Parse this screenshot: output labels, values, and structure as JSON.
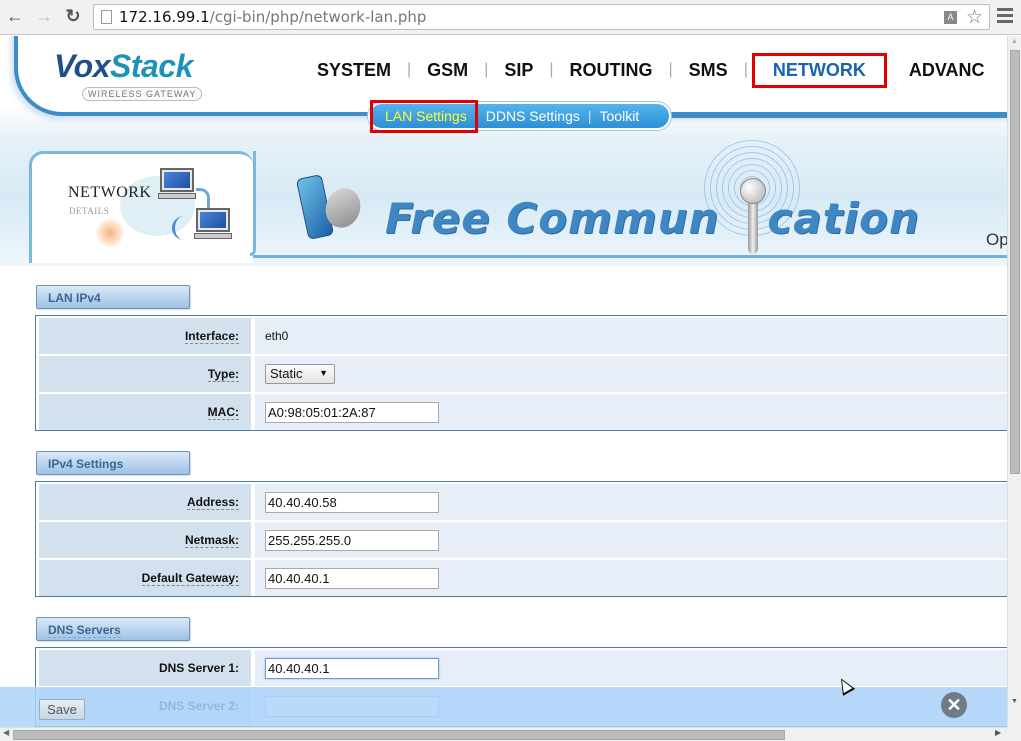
{
  "browser": {
    "url_host": "172.16.99.1",
    "url_path": "/cgi-bin/php/network-lan.php",
    "icons": [
      "back-arrow-icon",
      "forward-arrow-icon",
      "reload-icon",
      "page-icon",
      "translate-icon",
      "star-icon",
      "menu-icon"
    ]
  },
  "logo": {
    "vox": "Vox",
    "stack": "Stack",
    "subtitle": "WIRELESS GATEWAY"
  },
  "main_nav": {
    "items": [
      {
        "label": "SYSTEM"
      },
      {
        "label": "GSM"
      },
      {
        "label": "SIP"
      },
      {
        "label": "ROUTING"
      },
      {
        "label": "SMS"
      },
      {
        "label": "NETWORK",
        "active": true
      },
      {
        "label": "ADVANC"
      }
    ],
    "separator": "|"
  },
  "sub_nav": {
    "items": [
      {
        "label": "LAN Settings",
        "active": true
      },
      {
        "label": "DDNS Settings"
      },
      {
        "label": "Toolkit"
      }
    ],
    "separator": "|"
  },
  "page_card": {
    "title": "NETWORK",
    "subtitle": "DETAILS"
  },
  "banner": {
    "text_left": "Free Commun",
    "text_right": "cation",
    "clipped_text": "Op"
  },
  "sections": [
    {
      "title": "LAN IPv4",
      "rows": [
        {
          "label": "Interface:",
          "type": "text",
          "value": "eth0"
        },
        {
          "label": "Type:",
          "type": "select",
          "value": "Static"
        },
        {
          "label": "MAC:",
          "type": "input",
          "value": "A0:98:05:01:2A:87"
        }
      ]
    },
    {
      "title": "IPv4 Settings",
      "rows": [
        {
          "label": "Address:",
          "type": "input",
          "value": "40.40.40.58"
        },
        {
          "label": "Netmask:",
          "type": "input",
          "value": "255.255.255.0"
        },
        {
          "label": "Default Gateway:",
          "type": "input",
          "value": "40.40.40.1"
        }
      ]
    },
    {
      "title": "DNS Servers",
      "rows": [
        {
          "label": "DNS Server 1:",
          "type": "input",
          "value": "40.40.40.1",
          "focused": true
        },
        {
          "label": "DNS Server 2:",
          "type": "input",
          "value": ""
        }
      ]
    }
  ],
  "save_bar": {
    "save_label": "Save",
    "close_glyph": "✕"
  },
  "colors": {
    "nav_active": "#1a63b0",
    "highlight_box": "#e00000",
    "subnav_active_text": "#ffff33",
    "section_header_text": "#3e6494",
    "label_cell_bg": "#d3e1ef",
    "value_cell_bg": "#e7eef7"
  }
}
